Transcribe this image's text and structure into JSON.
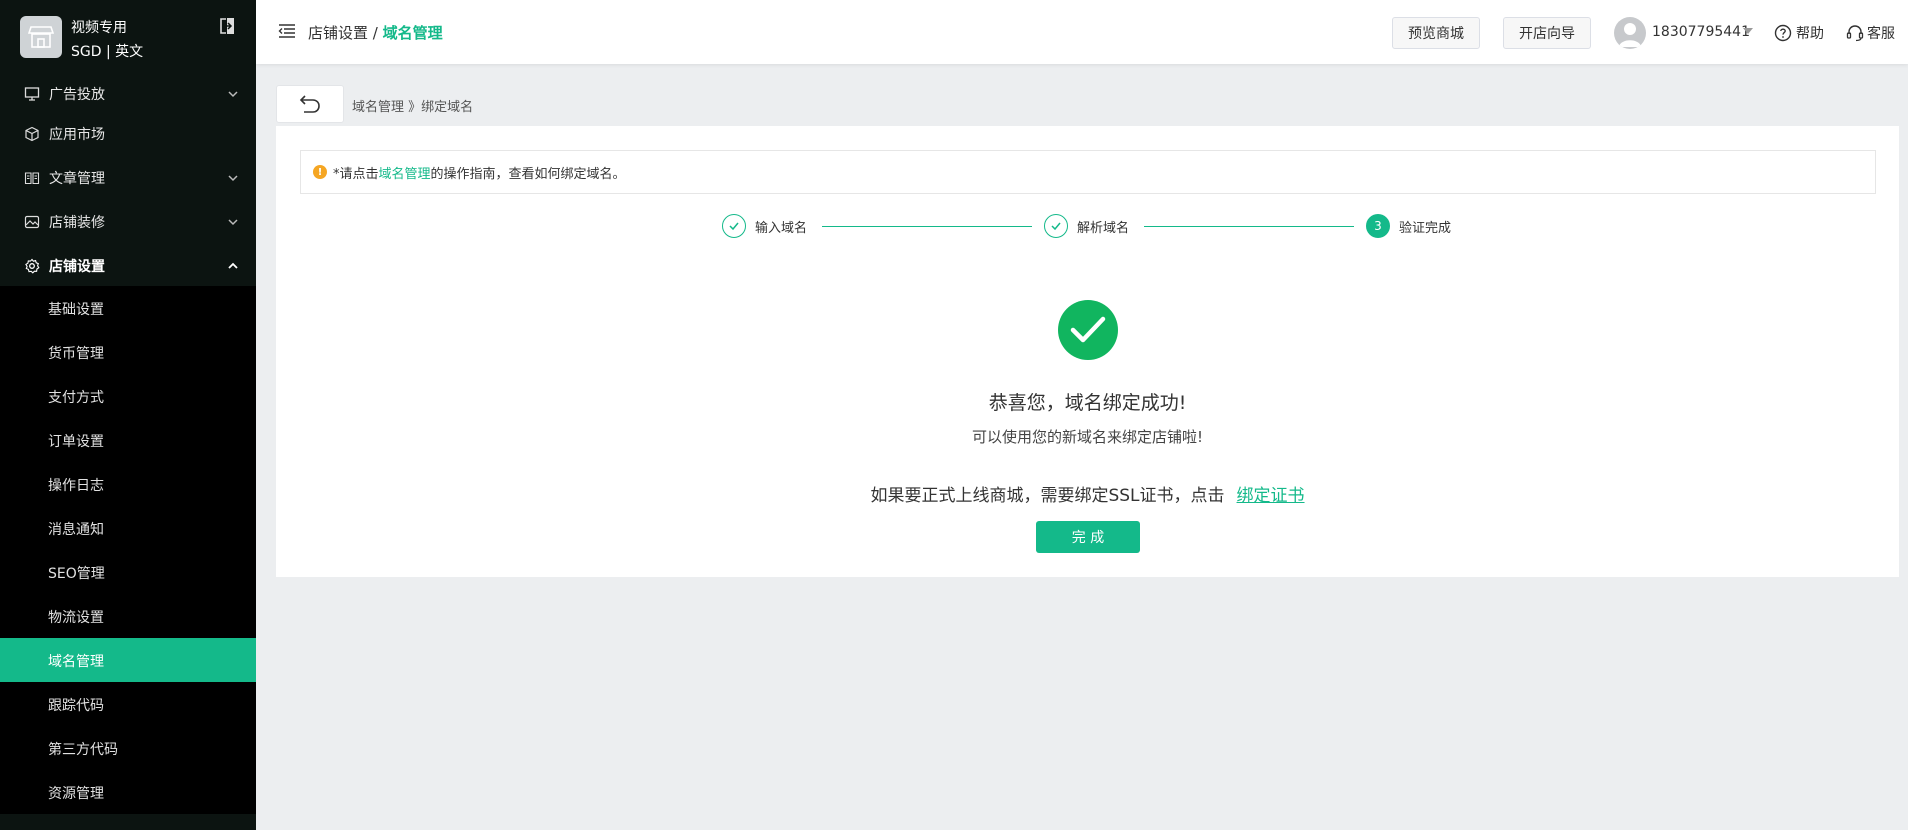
{
  "sidebar": {
    "shop_name": "视频专用",
    "shop_sub": "SGD | 英文",
    "groups": [
      {
        "label": "广告投放",
        "icon": "monitor-icon",
        "has_chevron": true
      },
      {
        "label": "应用市场",
        "icon": "cube-icon",
        "has_chevron": false
      },
      {
        "label": "文章管理",
        "icon": "book-icon",
        "has_chevron": true
      },
      {
        "label": "店铺装修",
        "icon": "image-icon",
        "has_chevron": true
      },
      {
        "label": "店铺设置",
        "icon": "gear-icon",
        "has_chevron": true,
        "expanded": true
      }
    ],
    "sub_items": [
      {
        "label": "基础设置"
      },
      {
        "label": "货币管理"
      },
      {
        "label": "支付方式"
      },
      {
        "label": "订单设置"
      },
      {
        "label": "操作日志"
      },
      {
        "label": "消息通知"
      },
      {
        "label": "SEO管理"
      },
      {
        "label": "物流设置"
      },
      {
        "label": "域名管理",
        "active": true
      },
      {
        "label": "跟踪代码"
      },
      {
        "label": "第三方代码"
      },
      {
        "label": "资源管理"
      }
    ]
  },
  "header": {
    "breadcrumb_parent": "店铺设置",
    "breadcrumb_sep": " / ",
    "breadcrumb_current": "域名管理",
    "preview_label": "预览商城",
    "guide_label": "开店向导",
    "user_phone": "18307795441",
    "help_label": "帮助",
    "service_label": "客服"
  },
  "content": {
    "sub_breadcrumb": "域名管理 》绑定域名",
    "notice_prefix": "*请点击 ",
    "notice_link": "域名管理",
    "notice_suffix": "的操作指南，查看如何绑定域名。",
    "steps": [
      {
        "label": "输入域名",
        "status": "done"
      },
      {
        "label": "解析域名",
        "status": "done"
      },
      {
        "label": "验证完成",
        "status": "current",
        "number": "3"
      }
    ],
    "success_title": "恭喜您，域名绑定成功!",
    "success_sub": "可以使用您的新域名来绑定店铺啦!",
    "ssl_text": "如果要正式上线商城，需要绑定SSL证书，点击",
    "ssl_link": "绑定证书",
    "done_label": "完 成"
  },
  "colors": {
    "accent": "#14b98a",
    "success": "#11b55f",
    "sidebar_bg": "#0c1411",
    "warning": "#f5a623"
  }
}
